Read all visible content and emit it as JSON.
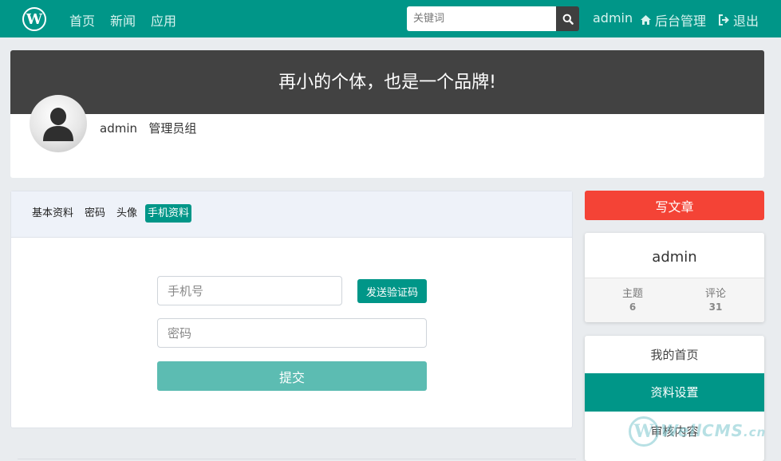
{
  "navbar": {
    "logo_letter": "W",
    "links": [
      "首页",
      "新闻",
      "应用"
    ],
    "search_placeholder": "关键词",
    "user": "admin",
    "admin_link": "后台管理",
    "logout_link": "退出"
  },
  "banner": {
    "slogan": "再小的个体，也是一个品牌!",
    "username": "admin",
    "group": "管理员组"
  },
  "tabs": [
    "基本资料",
    "密码",
    "头像",
    "手机资料"
  ],
  "active_tab": 3,
  "form": {
    "phone_placeholder": "手机号",
    "send_code_label": "发送验证码",
    "password_placeholder": "密码",
    "submit_label": "提交"
  },
  "sidebar": {
    "write_label": "写文章",
    "username": "admin",
    "stats": [
      {
        "label": "主题",
        "value": "6"
      },
      {
        "label": "评论",
        "value": "31"
      }
    ],
    "menu": [
      "我的首页",
      "资料设置",
      "审核内容"
    ],
    "active_menu": 1
  },
  "watermark": {
    "logo_letter": "W",
    "text": "WellCMS",
    "suffix": ".cn"
  },
  "colors": {
    "primary": "#009688",
    "danger": "#f44336",
    "banner": "#424242",
    "submit": "#5cbcb2"
  }
}
